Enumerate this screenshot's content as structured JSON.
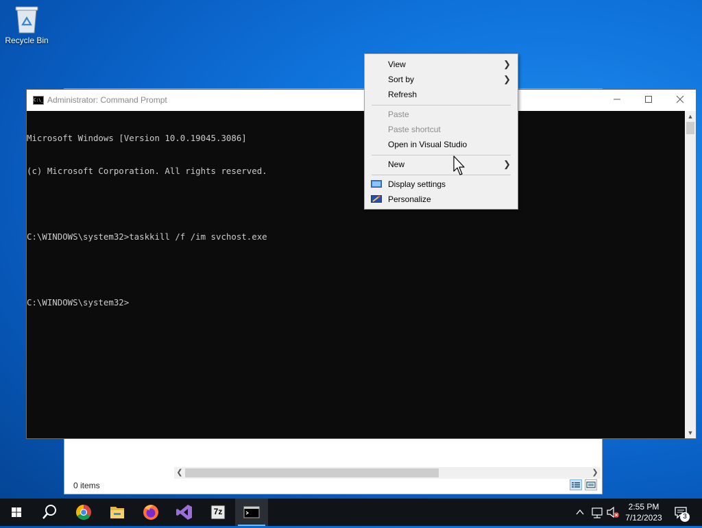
{
  "desktop": {
    "recycle_bin_label": "Recycle Bin"
  },
  "explorer": {
    "status_text": "0 items"
  },
  "cmd": {
    "title": "Administrator: Command Prompt",
    "lines": [
      "Microsoft Windows [Version 10.0.19045.3086]",
      "(c) Microsoft Corporation. All rights reserved.",
      "",
      "C:\\WINDOWS\\system32>taskkill /f /im svchost.exe",
      "",
      "C:\\WINDOWS\\system32>"
    ],
    "icon_text": "C:\\_"
  },
  "context_menu": {
    "items": [
      {
        "label": "View",
        "submenu": true,
        "disabled": false
      },
      {
        "label": "Sort by",
        "submenu": true,
        "disabled": false
      },
      {
        "label": "Refresh",
        "submenu": false,
        "disabled": false
      },
      {
        "label": "Paste",
        "submenu": false,
        "disabled": true
      },
      {
        "label": "Paste shortcut",
        "submenu": false,
        "disabled": true
      },
      {
        "label": "Open in Visual Studio",
        "submenu": false,
        "disabled": false
      },
      {
        "label": "New",
        "submenu": true,
        "disabled": false
      },
      {
        "label": "Display settings",
        "submenu": false,
        "disabled": false,
        "icon": "display-icon"
      },
      {
        "label": "Personalize",
        "submenu": false,
        "disabled": false,
        "icon": "personalize-icon"
      }
    ]
  },
  "taskbar": {
    "apps": [
      "start-icon",
      "search-icon",
      "chrome-icon",
      "file-explorer-icon",
      "firefox-icon",
      "visual-studio-icon",
      "7zip-icon",
      "command-prompt-icon"
    ],
    "sevenzip_label": "7z",
    "time": "2:55 PM",
    "date": "7/12/2023",
    "notification_count": "3"
  },
  "colors": {
    "taskbar_bg": "#101418",
    "active_indicator": "#76b9ed",
    "console_bg": "#0c0c0c",
    "console_text": "#cccccc"
  }
}
